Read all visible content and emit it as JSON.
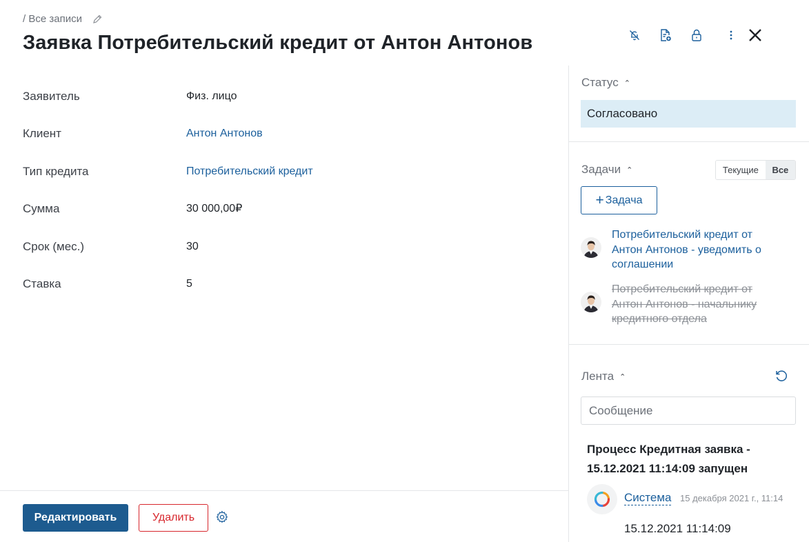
{
  "header": {
    "breadcrumb": "/ Все записи",
    "title": "Заявка Потребительский кредит от Антон Антонов",
    "icons": [
      "bell-off-icon",
      "file-add-icon",
      "lock-icon",
      "more-vertical-icon",
      "close-icon"
    ]
  },
  "fields": [
    {
      "label": "Заявитель",
      "value": "Физ. лицо",
      "link": false
    },
    {
      "label": "Клиент",
      "value": "Антон Антонов",
      "link": true
    },
    {
      "label": "Тип кредита",
      "value": "Потребительский кредит",
      "link": true
    },
    {
      "label": "Сумма",
      "value": "30 000,00₽",
      "link": false
    },
    {
      "label": "Срок (мес.)",
      "value": "30",
      "link": false
    },
    {
      "label": "Ставка",
      "value": "5",
      "link": false
    }
  ],
  "footer": {
    "edit_label": "Редактировать",
    "delete_label": "Удалить"
  },
  "status": {
    "title": "Статус",
    "value": "Согласовано"
  },
  "tasks": {
    "title": "Задачи",
    "toggle_current": "Текущие",
    "toggle_all": "Все",
    "toggle_selected": "Все",
    "add_label": "Задача",
    "items": [
      {
        "text": "Потребительский кредит от Антон Антонов - уведомить о соглашении",
        "done": false
      },
      {
        "text": "Потребительский кредит от Антон Антонов - начальнику кредитного отдела",
        "done": true
      }
    ]
  },
  "feed": {
    "title": "Лента",
    "message_placeholder": "Сообщение",
    "entry_title": "Процесс Кредитная заявка - 15.12.2021 11:14:09 запущен",
    "author": "Система",
    "date": "15 декабря 2021 г., 11:14",
    "body": "15.12.2021 11:14:09"
  },
  "colors": {
    "primary": "#1d5b8f",
    "link": "#1b5f9c",
    "danger": "#d7262c",
    "status_bg": "#dcedf6"
  }
}
